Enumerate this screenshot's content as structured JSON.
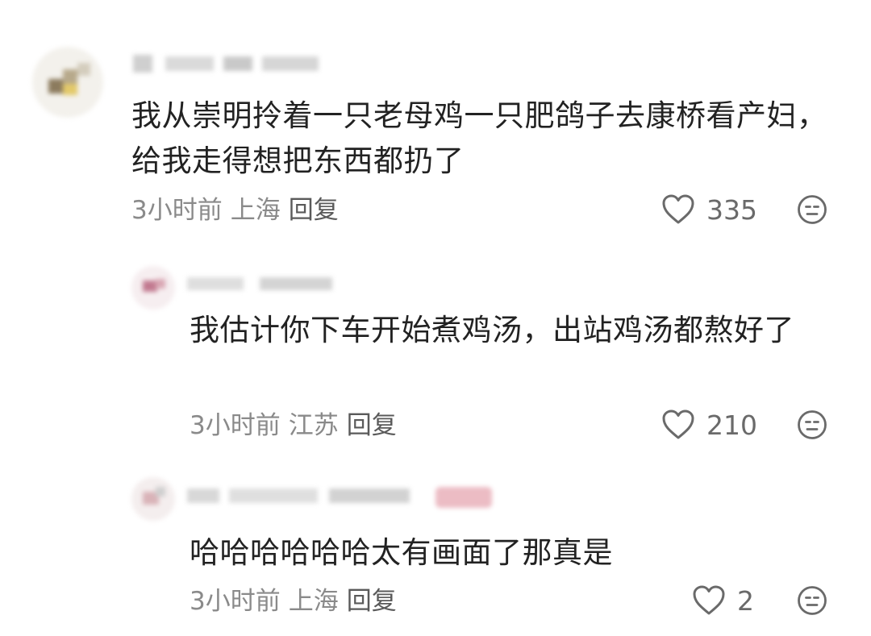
{
  "comments": [
    {
      "text": "我从崇明拎着一只老母鸡一只肥鸽子去康桥看产妇，给我走得想把东西都扔了",
      "time": "3小时前",
      "location": "上海",
      "reply_label": "回复",
      "likes": "335",
      "avatar_color": "#d8c7a0"
    },
    {
      "text": "我估计你下车开始煮鸡汤，出站鸡汤都熬好了",
      "time": "3小时前",
      "location": "江苏",
      "reply_label": "回复",
      "likes": "210",
      "avatar_color": "#c27a90"
    },
    {
      "text": "哈哈哈哈哈哈太有画面了那真是",
      "time": "3小时前",
      "location": "上海",
      "reply_label": "回复",
      "likes": "2",
      "avatar_color": "#d9b3b8"
    }
  ],
  "icons": {
    "like": "heart-outline-icon",
    "dislike": "meh-face-icon"
  },
  "colors": {
    "text": "#222222",
    "meta": "#8a8a8a",
    "icon": "#6a6a6a"
  }
}
